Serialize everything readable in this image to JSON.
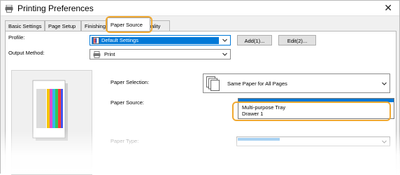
{
  "window": {
    "title": "Printing Preferences",
    "close_glyph": "✕"
  },
  "tabs": [
    {
      "label": "Basic Settings"
    },
    {
      "label": "Page Setup"
    },
    {
      "label": "Finishing"
    },
    {
      "label": "Paper Source",
      "active": true
    },
    {
      "label": "Quality"
    }
  ],
  "profile": {
    "label": "Profile:",
    "value": "Default Settings",
    "icon": "profile-icon",
    "add_label": "Add(1)...",
    "edit_label": "Edit(2)..."
  },
  "output_method": {
    "label": "Output Method:",
    "value": "Print",
    "icon": "printer-icon"
  },
  "paper_selection": {
    "label": "Paper Selection:",
    "value": "Same Paper for All Pages",
    "icon": "pages-stack-icon"
  },
  "paper_source": {
    "label": "Paper Source:",
    "options": [
      "Multi-purpose Tray",
      "Drawer 1"
    ]
  },
  "paper_type": {
    "label": "Paper Type:"
  },
  "colors": {
    "accent": "#0078d7",
    "callout": "#f0a830"
  }
}
